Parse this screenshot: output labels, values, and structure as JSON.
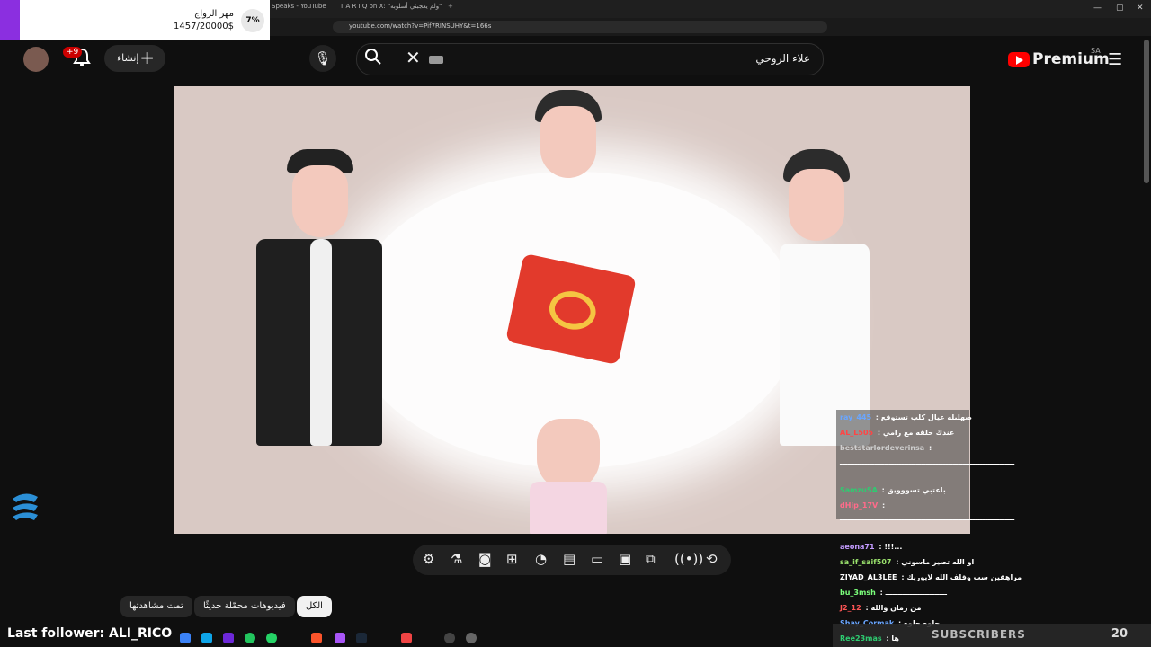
{
  "browser": {
    "tabs": [
      "Speaks - YouTube",
      "T A R I Q on X: \"ولم يعجبني أسلوبه\""
    ],
    "url": "youtube.com/watch?v=Pif7RINSUHY&t=166s"
  },
  "goal": {
    "title": "مهر الزواج",
    "amount": "1457/20000$",
    "percent": "7%",
    "progress": 0.07,
    "accent": "#8b2fe0"
  },
  "header": {
    "notif_count": "+9",
    "create_label": "إنشاء",
    "search_query": "علاء الروحي",
    "brand": "Premium",
    "region": "SA"
  },
  "chips": [
    "الكل",
    "فيديوهات محمّلة حديثًا",
    "تمت مشاهدتها"
  ],
  "chat": [
    {
      "user": "ray_445",
      "text": "صهلبله عيال كلب تستوقع",
      "color": "#6aa6ff"
    },
    {
      "user": "AL_L505",
      "text": "عندك حلقه مع رامي",
      "color": "#ff4444"
    },
    {
      "user": "beststarlordeverinsa",
      "text": "",
      "color": "#cfcfcf"
    },
    {
      "user": "",
      "text": "ـــــــــــــــــــــــــــــــــــــــــــــــــــــــــــــــــــــــ",
      "color": "#ffffff"
    },
    {
      "user": "SamzuSA",
      "text": "باعتبي تسووويق",
      "color": "#2ecc71"
    },
    {
      "user": "dHip_17V",
      "text": "",
      "color": "#ff6b8a"
    },
    {
      "user": "",
      "text": "ـــــــــــــــــــــــــــــــــــــــــــــــــــــــــــــــــــــــ",
      "color": "#ffffff"
    },
    {
      "user": "aeona71",
      "text": "!!!...",
      "color": "#c39bff"
    },
    {
      "user": "sa_if_saif507",
      "text": "او الله تصير ماسوني",
      "color": "#9be36d"
    },
    {
      "user": "ZIYAD_AL3LEE",
      "text": "مراهقين سب وقلف الله لايوريك",
      "color": "#ffffff"
    },
    {
      "user": "bu_3msh",
      "text": "ـــــــــــــــــــــــــ",
      "color": "#7bff7b"
    },
    {
      "user": "J2_12",
      "text": "من زمان والله",
      "color": "#ff5555"
    },
    {
      "user": "Shay_Cormak",
      "text": "حلوه حلوه",
      "color": "#6aa6ff"
    },
    {
      "user": "Ree23mas",
      "text": "ها",
      "color": "#2ecc71"
    }
  ],
  "overlay": {
    "last_follower": "Last follower: ALI_RICO",
    "subscribers_label": "SUBSCRIBERS",
    "subscribers_count": "20"
  },
  "icons": [
    "settings-icon",
    "flask-icon",
    "camera-icon",
    "add-clip-icon",
    "speed-icon",
    "subtitles-icon",
    "theater-icon",
    "miniplayer-icon",
    "cast-icon",
    "live-icon",
    "loop-icon"
  ]
}
